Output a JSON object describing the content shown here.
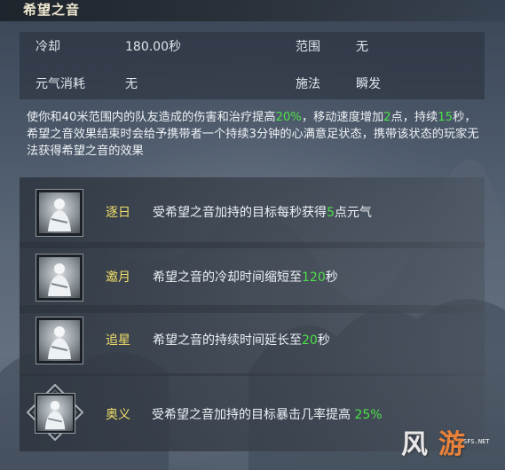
{
  "title": "希望之音",
  "attributes": {
    "cooldown_label": "冷却",
    "cooldown_value": "180.00秒",
    "range_label": "范围",
    "range_value": "无",
    "qi_label": "元气消耗",
    "qi_value": "无",
    "cast_label": "施法",
    "cast_value": "瞬发"
  },
  "description": {
    "p1": "使你和40米范围内的队友造成的伤害和治疗提高",
    "v1": "20%",
    "p2": "，移动速度增加",
    "v2": "2",
    "p3": "点，持续",
    "v3": "15",
    "p4": "秒，希望之音效果结束时会给予携带者一个持续3分钟的心满意足状态，携带该状态的玩家无法获得希望之音的效果"
  },
  "talents": [
    {
      "name": "逐日",
      "t1": "受希望之音加持的目标每秒获得",
      "v": "5",
      "t2": "点元气"
    },
    {
      "name": "邀月",
      "t1": "希望之音的冷却时间缩短至",
      "v": "120",
      "t2": "秒"
    },
    {
      "name": "追星",
      "t1": "希望之音的持续时间延长至",
      "v": "20",
      "t2": "秒"
    },
    {
      "name": "奥义",
      "t1": "受希望之音加持的目标暴击几率提高 ",
      "v": "25%",
      "t2": ""
    }
  ],
  "watermark": {
    "main1": "风",
    "main2": "游",
    "small": "SFS.NET"
  },
  "colors": {
    "highlight_green": "#4de04a",
    "talent_name_yellow": "#f2e06a",
    "title": "#f1e9d2"
  }
}
